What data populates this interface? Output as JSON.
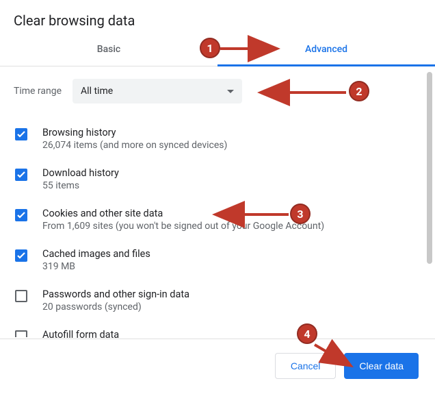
{
  "title": "Clear browsing data",
  "tabs": {
    "basic": "Basic",
    "advanced": "Advanced"
  },
  "timerange": {
    "label": "Time range",
    "value": "All time"
  },
  "options": [
    {
      "title": "Browsing history",
      "subtitle": "26,074 items (and more on synced devices)"
    },
    {
      "title": "Download history",
      "subtitle": "55 items"
    },
    {
      "title": "Cookies and other site data",
      "subtitle": "From 1,609 sites (you won't be signed out of your Google Account)"
    },
    {
      "title": "Cached images and files",
      "subtitle": "319 MB"
    },
    {
      "title": "Passwords and other sign-in data",
      "subtitle": "20 passwords (synced)"
    },
    {
      "title": "Autofill form data",
      "subtitle": ""
    }
  ],
  "buttons": {
    "cancel": "Cancel",
    "clear": "Clear data"
  },
  "markers": {
    "m1": "1",
    "m2": "2",
    "m3": "3",
    "m4": "4"
  }
}
